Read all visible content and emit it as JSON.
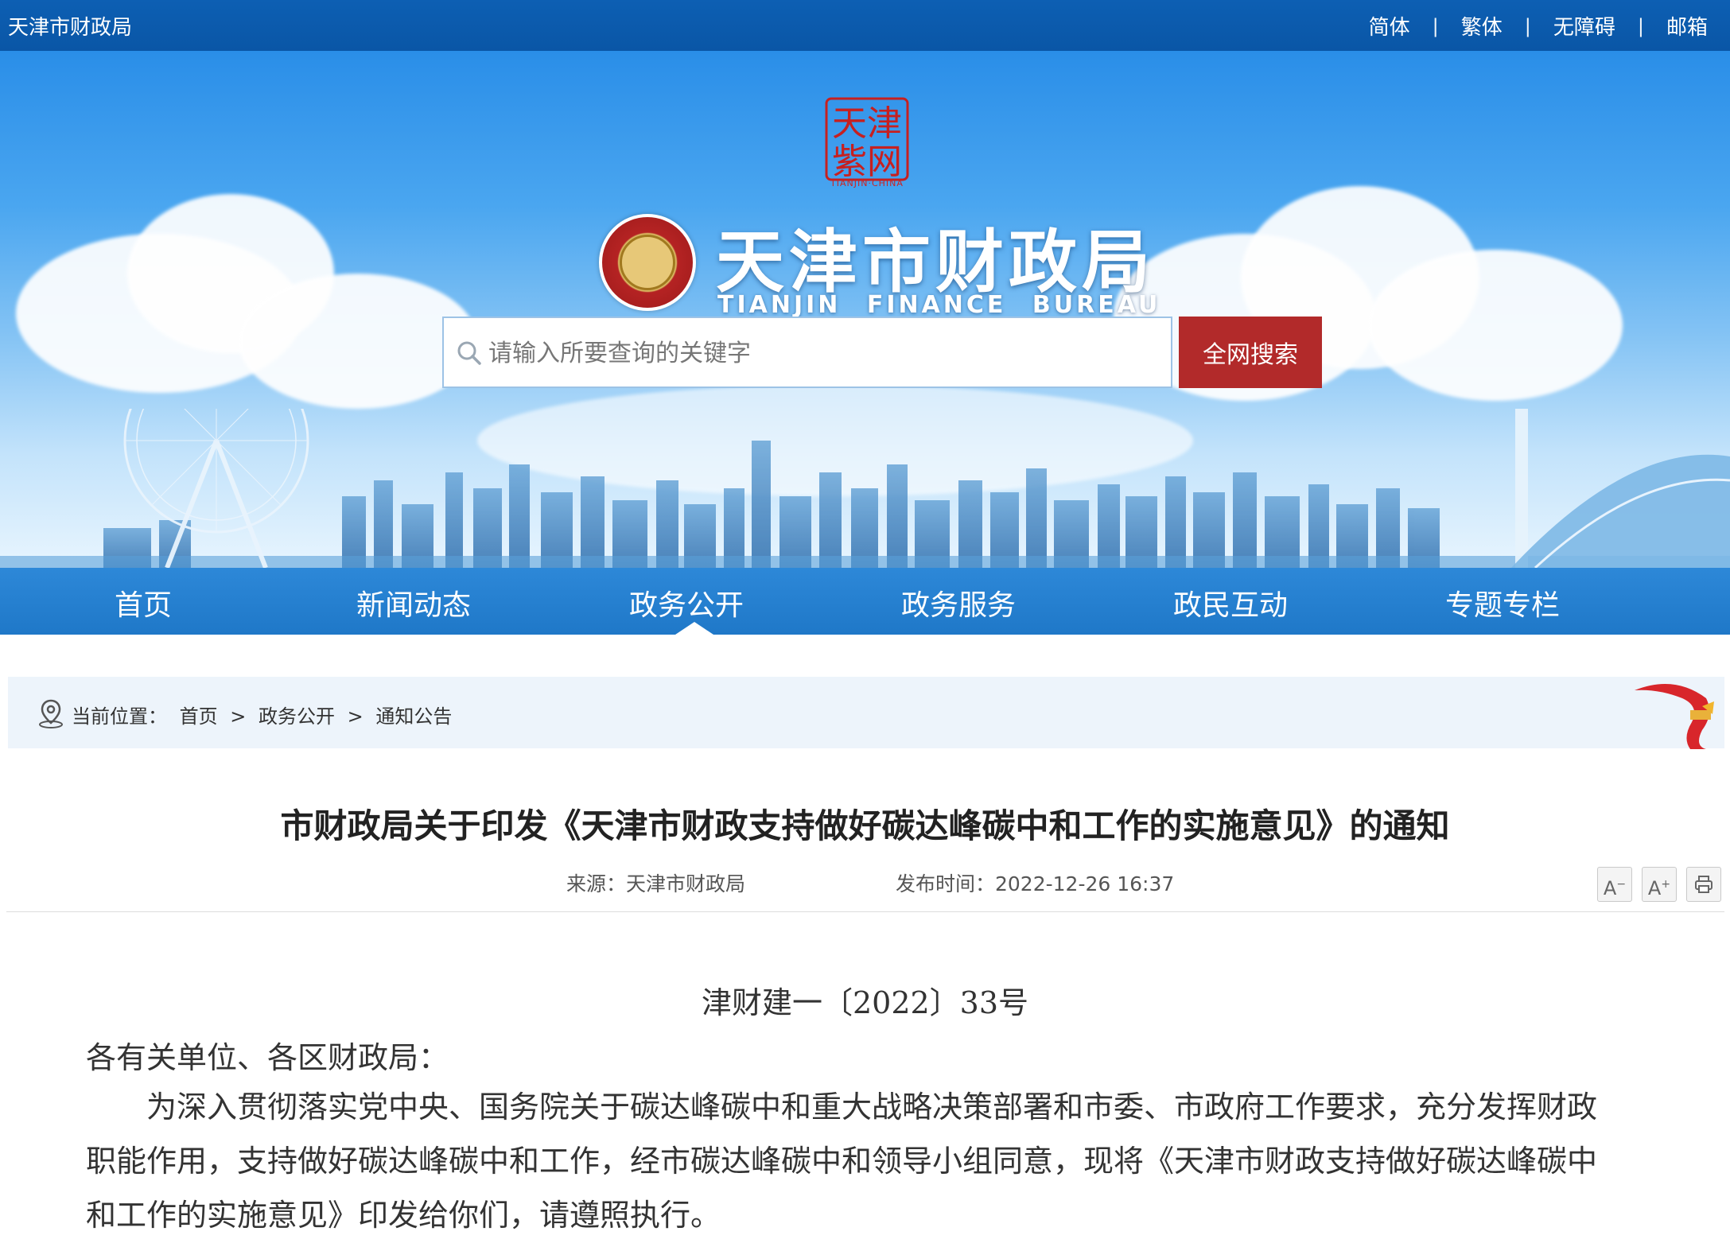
{
  "topbar": {
    "site_name": "天津市财政局",
    "links": [
      "简体",
      "繁体",
      "无障碍",
      "邮箱"
    ]
  },
  "banner": {
    "seal_text": "天津紫网",
    "seal_caption": "TIANJIN·CHINA",
    "title": "天津市财政局",
    "title_en": "TIANJIN FINANCE BUREAU"
  },
  "search": {
    "placeholder": "请输入所要查询的关键字",
    "button_label": "全网搜索"
  },
  "nav": {
    "items": [
      "首页",
      "新闻动态",
      "政务公开",
      "政务服务",
      "政民互动",
      "专题专栏"
    ],
    "active": "政务公开"
  },
  "breadcrumb": {
    "label": "当前位置：",
    "path": [
      "首页",
      ">",
      "政务公开",
      ">",
      "通知公告"
    ]
  },
  "article": {
    "title": "市财政局关于印发《天津市财政支持做好碳达峰碳中和工作的实施意见》的通知",
    "source": "来源：天津市财政局",
    "published": "发布时间：2022-12-26 16:37",
    "tools": {
      "decrease": "A",
      "increase": "A"
    },
    "doc_number": "津财建一〔2022〕33号",
    "salutation": "各有关单位、各区财政局：",
    "paragraph_1": "为深入贯彻落实党中央、国务院关于碳达峰碳中和重大战略决策部署和市委、市政府工作要求，充分发挥财政职能作用，支持做好碳达峰碳中和工作，经市碳达峰碳中和领导小组同意，现将《天津市财政支持做好碳达峰碳中和工作的实施意见》印发给你们，请遵照执行。"
  },
  "colors": {
    "topbar": "#0a56a6",
    "nav": "#1f78c8",
    "search_button": "#b22a2a",
    "breadcrumb_bg": "#edf4fb"
  }
}
